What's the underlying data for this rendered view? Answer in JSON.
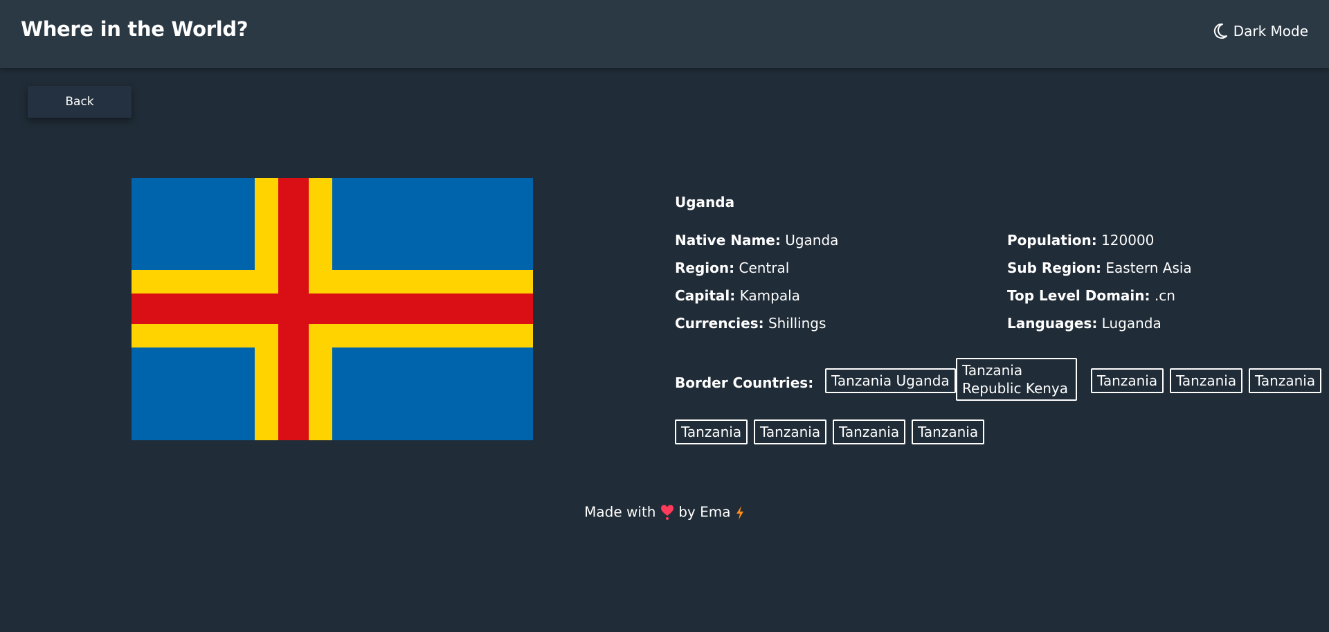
{
  "header": {
    "title": "Where in the World?",
    "mode_label": "Dark Mode",
    "mode_icon": "moon-icon"
  },
  "back_label": "Back",
  "flag": {
    "colors": {
      "blue": "#0064ad",
      "yellow": "#ffd300",
      "red": "#da0e15"
    }
  },
  "country": {
    "name": "Uganda",
    "native_name_label": "Native Name:",
    "native_name": "Uganda",
    "population_label": "Population:",
    "population": "120000",
    "region_label": "Region:",
    "region": "Central",
    "sub_region_label": "Sub Region:",
    "sub_region": "Eastern Asia",
    "capital_label": "Capital:",
    "capital": "Kampala",
    "tld_label": "Top Level Domain:",
    "tld": ".cn",
    "currencies_label": "Currencies:",
    "currencies": "Shillings",
    "languages_label": "Languages:",
    "languages": "Luganda"
  },
  "borders": {
    "label": "Border Countries:",
    "chips": [
      "Tanzania Uganda",
      "Tanzania Republic Kenya",
      "Tanzania",
      "Tanzania",
      "Tanzania",
      "Tanzania",
      "Tanzania",
      "Tanzania",
      "Tanzania"
    ]
  },
  "footer": {
    "made_with": "Made with",
    "by": "by Ema",
    "heart_icon": "heart-icon",
    "bolt_icon": "lightning-icon",
    "heart_color": "#ff3b5c",
    "bolt_color": "#ff8c1a"
  }
}
